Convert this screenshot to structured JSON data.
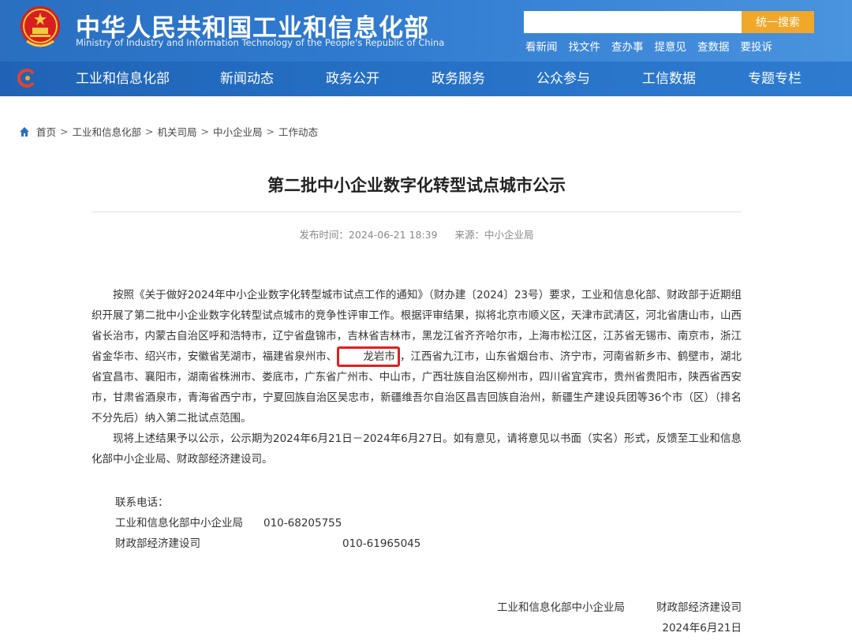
{
  "header": {
    "title": "中华人民共和国工业和信息化部",
    "subtitle": "Ministry of Industry and Information Technology of the People's Republic of China",
    "search_placeholder": "",
    "search_button": "统一搜索",
    "quick_links": [
      "看新闻",
      "找文件",
      "查办事",
      "提意见",
      "查数据",
      "要投诉"
    ]
  },
  "nav": {
    "items": [
      "工业和信息化部",
      "新闻动态",
      "政务公开",
      "政务服务",
      "公众参与",
      "工信数据",
      "专题专栏"
    ]
  },
  "breadcrumb": {
    "items": [
      "首页",
      "工业和信息化部",
      "机关司局",
      "中小企业局",
      "工作动态"
    ],
    "separator": ">"
  },
  "article": {
    "title": "第二批中小企业数字化转型试点城市公示",
    "publish_time": "发布时间：2024-06-21 18:39",
    "source": "来源：中小企业局",
    "para1_before": "按照《关于做好2024年中小企业数字化转型城市试点工作的通知》（财办建〔2024〕23号）要求，工业和信息化部、财政部于近期组织开展了第二批中小企业数字化转型试点城市的竞争性评审工作。根据评审结果，拟将北京市顺义区，天津市武清区，河北省唐山市，山西省长治市，内蒙古自治区呼和浩特市，辽宁省盘锦市，吉林省吉林市，黑龙江省齐齐哈尔市，上海市松江区，江苏省无锡市、南京市，浙江省金华市、绍兴市，安徽省芜湖市，福建省泉州市、",
    "para1_highlight": "龙岩市",
    "para1_after": "，江西省九江市，山东省烟台市、济宁市，河南省新乡市、鹤壁市，湖北省宜昌市、襄阳市，湖南省株洲市、娄底市，广东省广州市、中山市，广西壮族自治区柳州市，四川省宜宾市，贵州省贵阳市，陕西省西安市，甘肃省酒泉市，青海省西宁市，宁夏回族自治区吴忠市，新疆维吾尔自治区昌吉回族自治州，新疆生产建设兵团等36个市（区）（排名不分先后）纳入第二批试点范围。",
    "para2": "现将上述结果予以公示，公示期为2024年6月21日－2024年6月27日。如有意见，请将意见以书面（实名）形式，反馈至工业和信息化部中小企业局、财政部经济建设司。",
    "contact_label": "联系电话：",
    "contacts": [
      {
        "org": "工业和信息化部中小企业局",
        "phone": "010-68205755"
      },
      {
        "org": "财政部经济建设司",
        "phone": "010-61965045"
      }
    ],
    "signature_orgs": [
      "工业和信息化部中小企业局",
      "财政部经济建设司"
    ],
    "signature_date": "2024年6月21日"
  },
  "colors": {
    "header_blue": "#2f7ad0",
    "nav_blue": "#2671c6",
    "search_orange": "#f1a72a",
    "highlight_red": "#e0201b"
  }
}
